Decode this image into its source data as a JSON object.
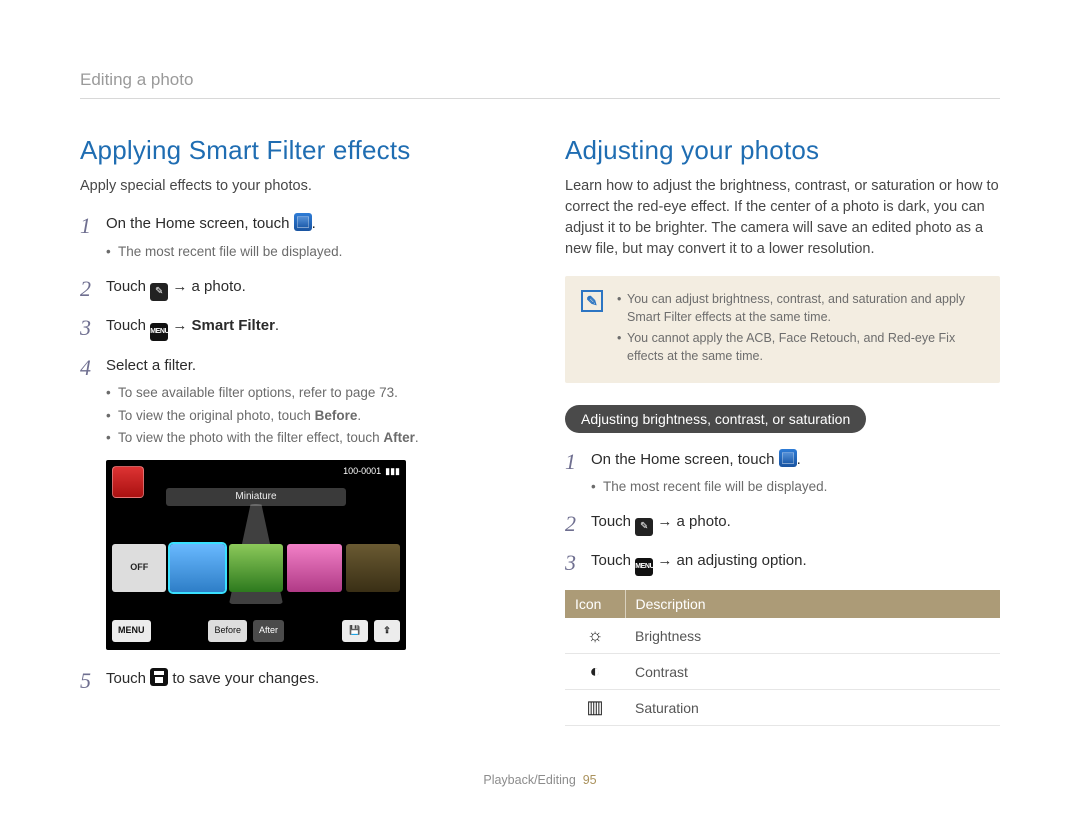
{
  "breadcrumb": "Editing a photo",
  "left": {
    "heading": "Applying Smart Filter effects",
    "intro": "Apply special effects to your photos.",
    "steps": {
      "s1": "On the Home screen, touch ",
      "s1_sub1": "The most recent file will be displayed.",
      "s2a": "Touch ",
      "s2b": " → a photo.",
      "s3a": "Touch ",
      "s3b": " → ",
      "s3c": "Smart Filter",
      "s3d": ".",
      "s4": "Select a filter.",
      "s4_sub1": "To see available filter options, refer to page 73.",
      "s4_sub2a": "To view the original photo, touch ",
      "s4_sub2b": "Before",
      "s4_sub2c": ".",
      "s4_sub3a": "To view the photo with the filter effect, touch ",
      "s4_sub3b": "After",
      "s4_sub3c": ".",
      "s5a": "Touch ",
      "s5b": " to save your changes."
    },
    "screen": {
      "file_counter": "100-0001",
      "filter_name": "Miniature",
      "off_label": "OFF",
      "menu_label": "MENU",
      "before_label": "Before",
      "after_label": "After"
    }
  },
  "right": {
    "heading": "Adjusting your photos",
    "intro": "Learn how to adjust the brightness, contrast, or saturation or how to correct the red-eye effect. If the center of a photo is dark, you can adjust it to be brighter. The camera will save an edited photo as a new file, but may convert it to a lower resolution.",
    "note1": "You can adjust brightness, contrast, and saturation and apply Smart Filter effects at the same time.",
    "note2": "You cannot apply the ACB, Face Retouch, and Red-eye Fix effects at the same time.",
    "pill": "Adjusting brightness, contrast, or saturation",
    "steps": {
      "s1": "On the Home screen, touch ",
      "s1_sub1": "The most recent file will be displayed.",
      "s2a": "Touch ",
      "s2b": " → a photo.",
      "s3a": "Touch ",
      "s3b": " → an adjusting option."
    },
    "table": {
      "head_icon": "Icon",
      "head_desc": "Description",
      "rows": [
        {
          "glyph": "☼",
          "label": "Brightness"
        },
        {
          "glyph": "◐",
          "label": "Contrast"
        },
        {
          "glyph": "▥",
          "label": "Saturation"
        }
      ]
    }
  },
  "footer": {
    "section": "Playback/Editing",
    "page": "95"
  },
  "icons": {
    "menu_text": "MENU"
  }
}
